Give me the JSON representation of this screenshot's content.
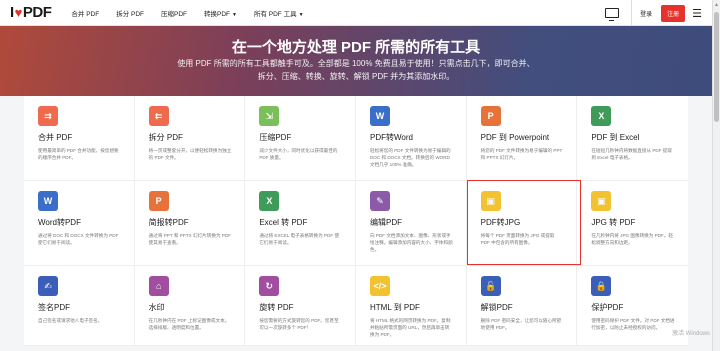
{
  "header": {
    "logo_left": "I",
    "logo_heart": "♥",
    "logo_right": "PDF",
    "nav": [
      "合并 PDF",
      "拆分 PDF",
      "压缩PDF",
      "转换PDF",
      "所有 PDF 工具"
    ],
    "login": "登录",
    "signup": "注册"
  },
  "hero": {
    "title": "在一个地方处理 PDF 所需的所有工具",
    "subtitle_line1": "使用 PDF 所需的所有工具都触手可及。全部都是 100% 免费且易于使用！只需点击几下，即可合并、",
    "subtitle_line2": "拆分、压缩、转换、旋转、解锁 PDF 并为其添加水印。"
  },
  "tools": [
    {
      "title": "合并 PDF",
      "desc": "使用最简单的 PDF 合并功能，按您想要的顺序合并 PDF。",
      "color": "#ef6b4d",
      "glyph": "⇉"
    },
    {
      "title": "拆分 PDF",
      "desc": "将一页或整套分开，以便轻松转换为独立的 PDF 文件。",
      "color": "#ef6b4d",
      "glyph": "⇇"
    },
    {
      "title": "压缩PDF",
      "desc": "减少文件大小，同时优化以获得最佳的 PDF 质量。",
      "color": "#7bbf5a",
      "glyph": "⇲"
    },
    {
      "title": "PDF转Word",
      "desc": "轻松将您的 PDF 文件转换为易于编辑的 DOC 和 DOCX 文档。转换后的 WORD 文档几乎 100% 准确。",
      "color": "#3b6ec8",
      "glyph": "W"
    },
    {
      "title": "PDF 到 Powerpoint",
      "desc": "将您的 PDF 文件转换为易于编辑的 PPT 和 PPTX 幻灯片。",
      "color": "#e8733a",
      "glyph": "P"
    },
    {
      "title": "PDF 到 Excel",
      "desc": "在短短几秒钟内将数据直接从 PDF 提取到 Excel 电子表格。",
      "color": "#3f9b5a",
      "glyph": "X"
    },
    {
      "title": "Word转PDF",
      "desc": "通过将 DOC 和 DOCX 文件转换为 PDF 使它们易于阅读。",
      "color": "#3b6ec8",
      "glyph": "W"
    },
    {
      "title": "简报转PDF",
      "desc": "通过将 PPT 和 PPTX 幻灯片转换为 PDF 使其易于查看。",
      "color": "#e8733a",
      "glyph": "P"
    },
    {
      "title": "Excel 转 PDF",
      "desc": "通过将 EXCEL 电子表格转换为 PDF 使它们易于阅读。",
      "color": "#3f9b5a",
      "glyph": "X"
    },
    {
      "title": "编辑PDF",
      "desc": "向 PDF 文档添加文本、图像、形状或手绘注释。编辑添加内容的大小、字体和颜色。",
      "color": "#8b5aa8",
      "glyph": "✎"
    },
    {
      "title": "PDF转JPG",
      "desc": "将每个 PDF 页面转换为 JPG 或提取 PDF 中包含的所有图像。",
      "color": "#f2c230",
      "glyph": "▣"
    },
    {
      "title": "JPG 转 PDF",
      "desc": "在几秒钟内将 JPG 图像转换为 PDF。轻松调整方向和边距。",
      "color": "#f2c230",
      "glyph": "▣"
    },
    {
      "title": "签名PDF",
      "desc": "自己签名或请求他人电子签名。",
      "color": "#3b5fb8",
      "glyph": "✍"
    },
    {
      "title": "水印",
      "desc": "在几秒钟内在 PDF 上标记图像或文本。选择排版、透明度和位置。",
      "color": "#a14ea1",
      "glyph": "⌂"
    },
    {
      "title": "旋转 PDF",
      "desc": "按您需要的方式旋转您的 PDF。您甚至可以一次旋转多个 PDF！",
      "color": "#a14ea1",
      "glyph": "↻"
    },
    {
      "title": "HTML 到 PDF",
      "desc": "将 HTML 格式的网页转换为 PDF。复制并粘贴所需页面的 URL，然后再单击转换为 PDF。",
      "color": "#f2c230",
      "glyph": "</>"
    },
    {
      "title": "解锁PDF",
      "desc": "删除 PDF 密码安全，让您可以随心所欲地使用 PDF。",
      "color": "#3b5fb8",
      "glyph": "🔓"
    },
    {
      "title": "保护PDF",
      "desc": "使用密码保护 PDF 文件。对 PDF 文档进行加密，以防止未经授权的访问。",
      "color": "#3b5fb8",
      "glyph": "🔒"
    }
  ],
  "watermark": "激活 Windows"
}
